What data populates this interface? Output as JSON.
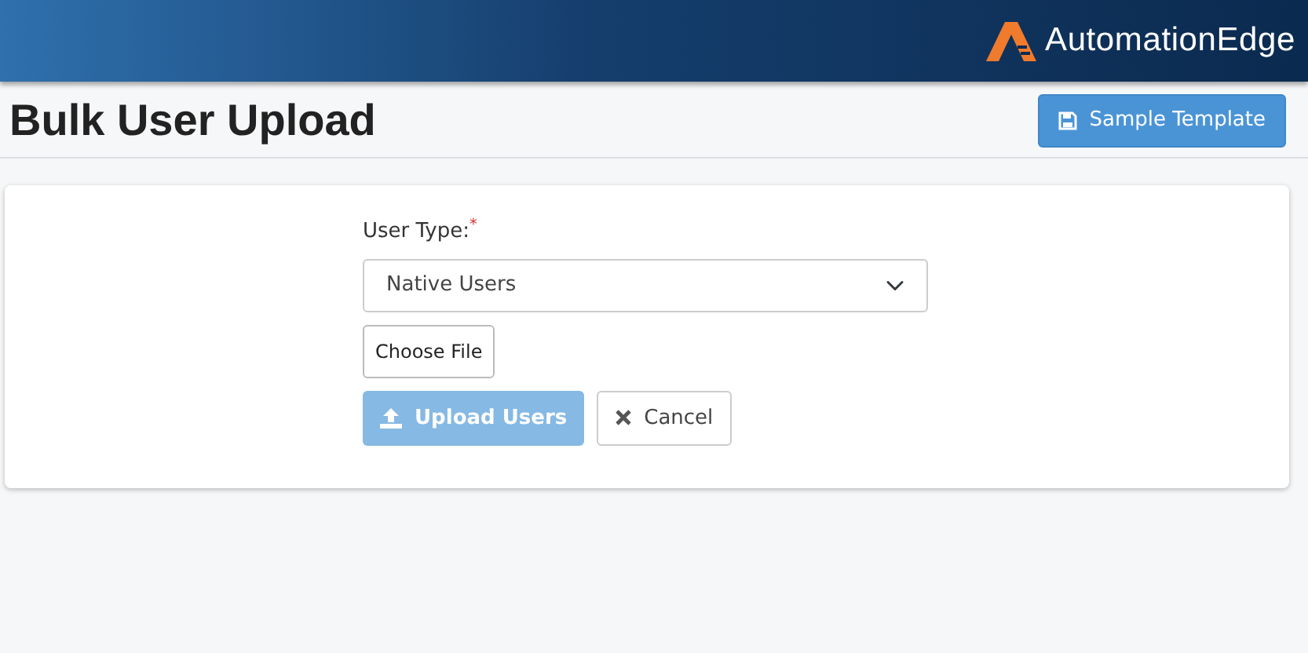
{
  "header": {
    "logo_text": "AutomationEdge"
  },
  "page": {
    "title": "Bulk User Upload",
    "template_button": "Sample Template"
  },
  "form": {
    "user_type_label": "User Type:",
    "required_mark": "*",
    "user_type_value": "Native Users",
    "file_button": "Choose File",
    "upload_button": {
      "label": "Upload Users",
      "disabled": true
    },
    "cancel_button": {
      "label": "Cancel"
    }
  }
}
